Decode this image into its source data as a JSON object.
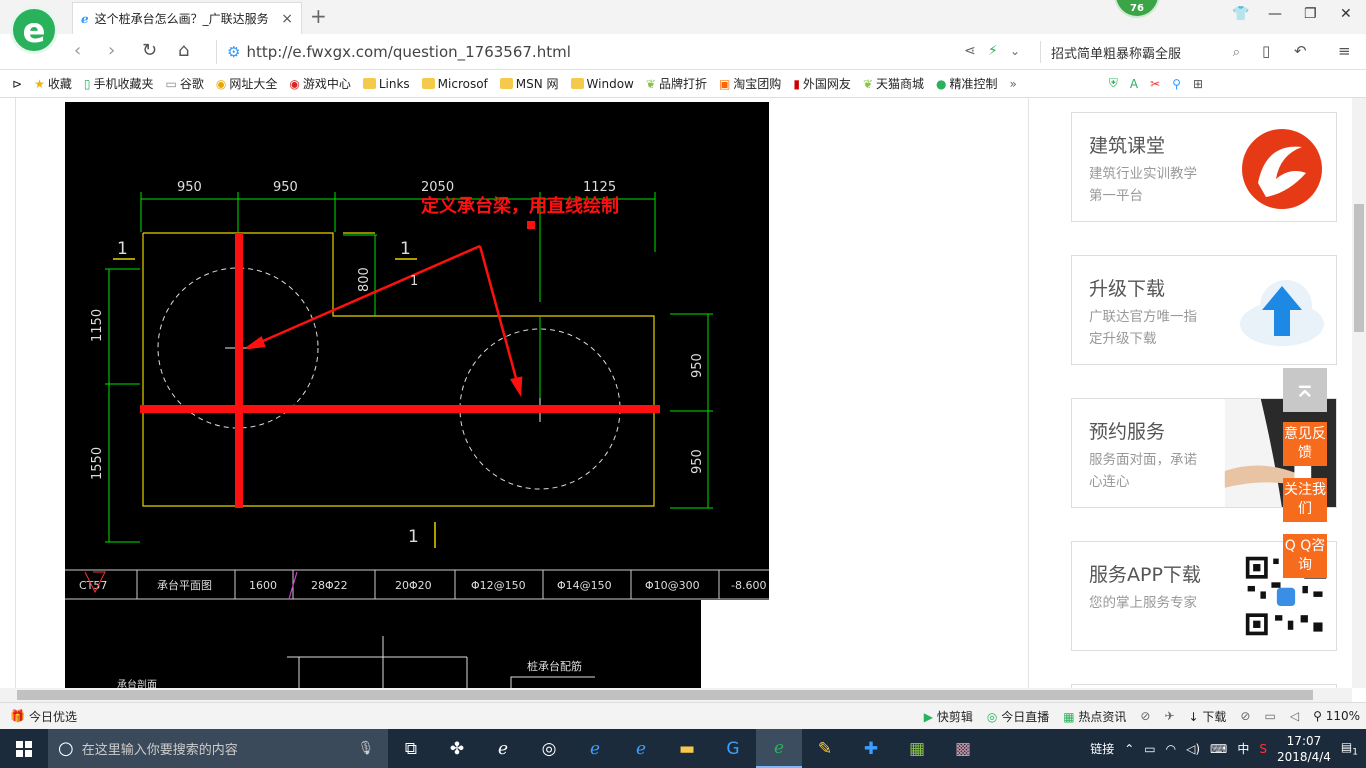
{
  "browser": {
    "tab_title": "这个桩承台怎么画？_广联达服务",
    "url": "http://e.fwxgx.com/question_1763567.html",
    "search_text": "招式简单粗暴称霸全服",
    "badge": "76",
    "logo": "e"
  },
  "bookmarks": [
    {
      "label": "收藏",
      "icon": "star-icon"
    },
    {
      "label": "手机收藏夹",
      "icon": "phone-icon"
    },
    {
      "label": "谷歌",
      "icon": "page-icon"
    },
    {
      "label": "网址大全",
      "icon": "globe-icon"
    },
    {
      "label": "游戏中心",
      "icon": "game-icon"
    },
    {
      "label": "Links",
      "icon": "folder-icon"
    },
    {
      "label": "Microsof",
      "icon": "folder-icon"
    },
    {
      "label": "MSN 网",
      "icon": "folder-icon"
    },
    {
      "label": "Window",
      "icon": "folder-icon"
    },
    {
      "label": "品牌打折",
      "icon": "leaf-icon"
    },
    {
      "label": "淘宝团购",
      "icon": "taobao-icon"
    },
    {
      "label": "外国网友",
      "icon": "flag-icon"
    },
    {
      "label": "天猫商城",
      "icon": "leaf-icon"
    },
    {
      "label": "精准控制",
      "icon": "wechat-icon"
    }
  ],
  "cad": {
    "dims_top": [
      "950",
      "950",
      "2050",
      "1125"
    ],
    "dims_left": [
      "1150",
      "1550"
    ],
    "dim_inner": "800",
    "dims_right": [
      "950",
      "950"
    ],
    "section_marks": [
      "1",
      "1",
      "1",
      "1"
    ],
    "annotation": "定义承台梁，用直线绘制",
    "table_cells": [
      "CT57",
      "承台平面图",
      "1600",
      "28Φ22",
      "20Φ20",
      "Φ12@150",
      "Φ14@150",
      "Φ10@300",
      "-8.600"
    ],
    "lower_label_1": "承台剖面",
    "lower_label_2": "桩承台配筋"
  },
  "sidebar": [
    {
      "title": "建筑课堂",
      "desc": "建筑行业实训教学第一平台",
      "icon": "glodon-logo-icon"
    },
    {
      "title": "升级下载",
      "desc": "广联达官方唯一指定升级下载",
      "icon": "cloud-upload-icon"
    },
    {
      "title": "预约服务",
      "desc": "服务面对面，承诺心连心",
      "icon": "handshake-icon"
    },
    {
      "title": "服务APP下载",
      "desc": "您的掌上服务专家",
      "icon": "qr-code-icon"
    }
  ],
  "float_buttons": [
    "意见反馈",
    "关注我们",
    "Q Q咨询"
  ],
  "status": {
    "left": "今日优选",
    "items": [
      "快剪辑",
      "今日直播",
      "热点资讯",
      "下载"
    ],
    "zoom": "110%"
  },
  "taskbar": {
    "search_placeholder": "在这里输入你要搜索的内容",
    "tray_label": "链接",
    "ime": "中",
    "time": "17:07",
    "date": "2018/4/4",
    "notify_count": "1"
  },
  "colors": {
    "accent": "#2ab15b",
    "cad_bg": "#000000",
    "cad_red": "#ff1010",
    "cad_green": "#00e000",
    "cad_yellow": "#e6d200",
    "float_orange": "#f66b1c"
  }
}
